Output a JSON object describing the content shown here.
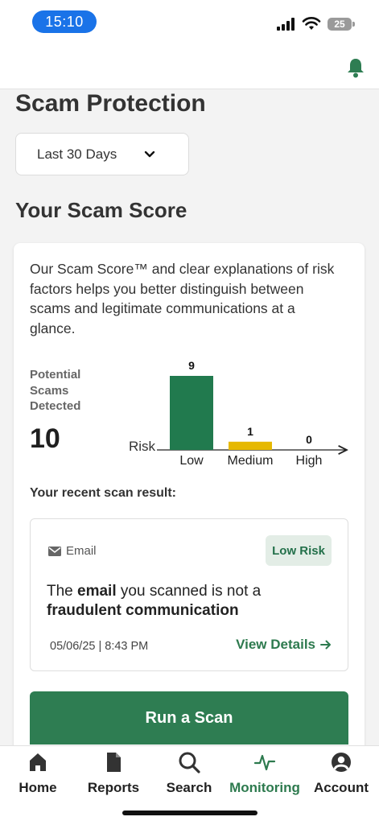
{
  "status": {
    "time": "15:10",
    "battery": "25"
  },
  "page": {
    "title": "Scam Protection"
  },
  "filter": {
    "selected": "Last 30 Days"
  },
  "score": {
    "section_title": "Your Scam Score",
    "description": "Our Scam Score™ and clear explanations of risk factors helps you better distinguish between scams and legitimate communications at a glance.",
    "potential_label": "Potential Scams Detected",
    "potential_count": "10"
  },
  "chart_data": {
    "type": "bar",
    "categories": [
      "Low",
      "Medium",
      "High"
    ],
    "values": [
      9,
      1,
      0
    ],
    "ylabel": "Risk",
    "colors": [
      "#217a4e",
      "#e6b800",
      "#9e9e9e"
    ]
  },
  "recent": {
    "label": "Your recent scan result:",
    "channel": "Email",
    "badge": "Low Risk",
    "msg_1": "The ",
    "msg_bold_1": "email",
    "msg_2": " you scanned is not a ",
    "msg_bold_2": "fraudulent communication",
    "timestamp": "05/06/25 | 8:43 PM",
    "view_details": "View Details"
  },
  "actions": {
    "run_scan": "Run a Scan"
  },
  "nav": {
    "items": [
      {
        "label": "Home",
        "icon": "home-icon"
      },
      {
        "label": "Reports",
        "icon": "document-icon"
      },
      {
        "label": "Search",
        "icon": "search-icon"
      },
      {
        "label": "Monitoring",
        "icon": "pulse-icon"
      },
      {
        "label": "Account",
        "icon": "account-icon"
      }
    ],
    "active": "Monitoring"
  },
  "colors": {
    "brand_green": "#2e7d52",
    "time_pill": "#1a73e8"
  }
}
